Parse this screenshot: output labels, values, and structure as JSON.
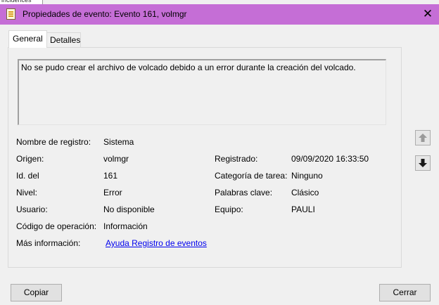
{
  "background_window": {
    "text": "incidences"
  },
  "window": {
    "title": "Propiedades de evento: Evento 161, volmgr",
    "titlebar_color": "#c56ed6",
    "icon": "event-log-document-icon",
    "close_glyph": "✕"
  },
  "tabs": [
    {
      "label": "General",
      "active": true
    },
    {
      "label": "Detalles",
      "active": false
    }
  ],
  "description": "No se pudo crear el archivo de volcado debido a un error durante la creación del volcado.",
  "fields": {
    "log_name": {
      "label": "Nombre de registro:",
      "value": "Sistema"
    },
    "source": {
      "label": "Origen:",
      "value": "volmgr"
    },
    "logged": {
      "label": "Registrado:",
      "value": "09/09/2020 16:33:50"
    },
    "event_id": {
      "label": "Id. del",
      "value": "161"
    },
    "task_category": {
      "label": "Categoría de tarea:",
      "value": "Ninguno"
    },
    "level": {
      "label": "Nivel:",
      "value": "Error"
    },
    "keywords": {
      "label": "Palabras clave:",
      "value": "Clásico"
    },
    "user": {
      "label": "Usuario:",
      "value": "No disponible"
    },
    "computer": {
      "label": "Equipo:",
      "value": "PAULI"
    },
    "opcode": {
      "label": "Código de operación:",
      "value": "Información"
    },
    "more_info": {
      "label": "Más información:",
      "link": "Ayuda Registro de eventos"
    }
  },
  "nav": {
    "up_icon": "arrow-up-icon",
    "down_icon": "arrow-down-icon"
  },
  "buttons": {
    "copy": "Copiar",
    "close": "Cerrar"
  },
  "colors": {
    "link": "#0000ee",
    "panel": "#f0f0f0"
  }
}
